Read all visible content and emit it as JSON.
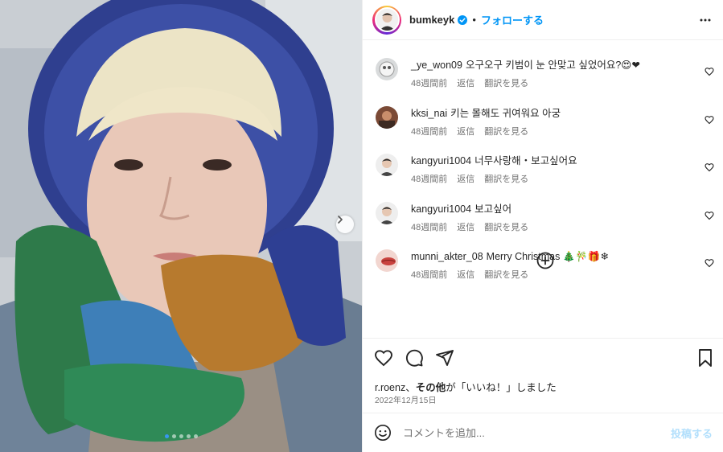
{
  "post": {
    "photo_alt": "selfie in knitted hood and scarf",
    "carousel_dots": 5,
    "carousel_active": 0
  },
  "header": {
    "username": "bumkeyk",
    "separator": "•",
    "follow_label": "フォローする",
    "verified": true
  },
  "comments": [
    {
      "user": "_ye_won09",
      "text": "오구오구 키범이 눈 안맞고 싶었어요?😍❤",
      "time": "48週間前",
      "reply": "返信",
      "translate": "翻訳を見る"
    },
    {
      "user": "kksi_nai",
      "text": "키는 몰해도 귀여워요 아궁",
      "time": "48週間前",
      "reply": "返信",
      "translate": "翻訳を見る"
    },
    {
      "user": "kangyuri1004",
      "text": "너무사랑해・보고싶어요",
      "time": "48週間前",
      "reply": "返信",
      "translate": "翻訳を見る"
    },
    {
      "user": "kangyuri1004",
      "text": "보고싶어",
      "time": "48週間前",
      "reply": "返信",
      "translate": "翻訳を見る"
    },
    {
      "user": "munni_akter_08",
      "text": "Merry Christmas 🎄🎋🎁❄",
      "time": "48週間前",
      "reply": "返信",
      "translate": "翻訳を見る"
    }
  ],
  "likes": {
    "user": "r.roenz",
    "sep": "、",
    "others": "その他",
    "suffix": "が「いいね！」しました"
  },
  "date": "2022年12月15日",
  "add_comment": {
    "placeholder": "コメントを追加...",
    "post_label": "投稿する"
  },
  "colors": {
    "accent": "#0095f6",
    "post_disabled": "#b2dffc",
    "meta": "#737373",
    "text": "#262626"
  }
}
